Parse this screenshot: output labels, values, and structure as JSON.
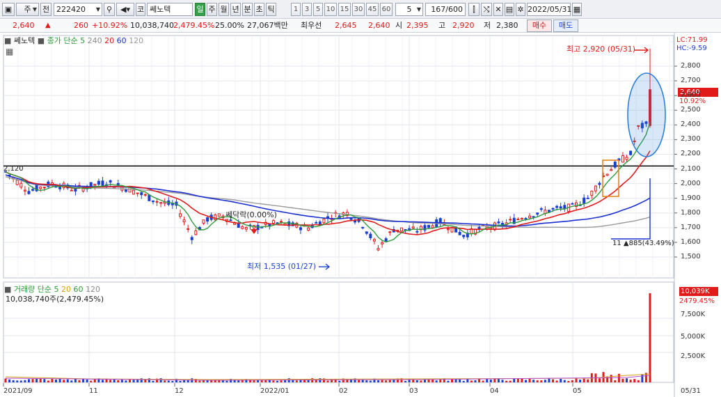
{
  "toolbar": {
    "market_type": "주",
    "prev_label": "전",
    "code": "222420",
    "code_prefix": "코",
    "stock_name": "쎄노텍",
    "periods": [
      "일",
      "주",
      "월",
      "년",
      "분",
      "초",
      "틱"
    ],
    "selected_period": "일",
    "intervals": [
      "1",
      "3",
      "5",
      "10",
      "15",
      "30",
      "45",
      "60"
    ],
    "interval_value": "5",
    "range": "167/600",
    "date": "2022/05/31"
  },
  "quote": {
    "price": "2,640",
    "direction": "▲",
    "change": "260",
    "change_pct": "+10.92%",
    "volume": "10,038,740",
    "volume_ratio": "2,479.45%",
    "turnover": "25.00%",
    "amount": "27,067백만",
    "best_label": "최우선",
    "best_ask": "2,645",
    "best_bid": "2,640",
    "open_label": "시",
    "open": "2,395",
    "high_label": "고",
    "high": "2,920",
    "low_label": "저",
    "low": "2,380",
    "buy_label": "매수",
    "sell_label": "매도"
  },
  "price_panel": {
    "legend_name": "쎄노텍",
    "legend_ma_label": "종가 단순",
    "legend_ma_periods": [
      "5",
      "240",
      "20",
      "60",
      "120"
    ],
    "lc": "LC:71.99",
    "hc": "HC:-9.59",
    "ref_line_label": "2,120",
    "high_annotation": "최고 2,920 (05/31)",
    "low_annotation": "최저 1,535 (01/27)",
    "gap_annotation": "쎄닥락(0.00%)",
    "range_annotation": "11 ▲885(43.49%)",
    "current_price_tag": "2,640",
    "current_pct_tag": "10.92%",
    "y_axis_labels": [
      "2,800",
      "2,700",
      "2,600",
      "2,500",
      "2,400",
      "2,300",
      "2,200",
      "2,100",
      "2,000",
      "1,900",
      "1,800",
      "1,700",
      "1,600",
      "1,500"
    ]
  },
  "volume_panel": {
    "legend_label": "거래량 단순",
    "legend_ma_periods": [
      "5",
      "20",
      "60",
      "120"
    ],
    "value_text": "10,038,740주(2,479.45%)",
    "current_tag": "10,039K",
    "current_pct_tag": "2479.45%",
    "y_axis_labels": [
      "7,500K",
      "5,000K",
      "2,500K"
    ]
  },
  "x_axis_labels": [
    "2021/09",
    "11",
    "12",
    "2022/01",
    "02",
    "03",
    "04",
    "05",
    "05/31"
  ],
  "colors": {
    "up": "#e11a1a",
    "down": "#1a3fcf",
    "ma5": "#2e9a3b",
    "ma20": "#e11a1a",
    "ma60": "#1a2fd0",
    "ma120": "#9a9a9a",
    "ma240": "#7a4a9a",
    "selected_period": "#35a04a",
    "highlight_ellipse": "#2d7fd8",
    "box": "#e8821e"
  }
}
